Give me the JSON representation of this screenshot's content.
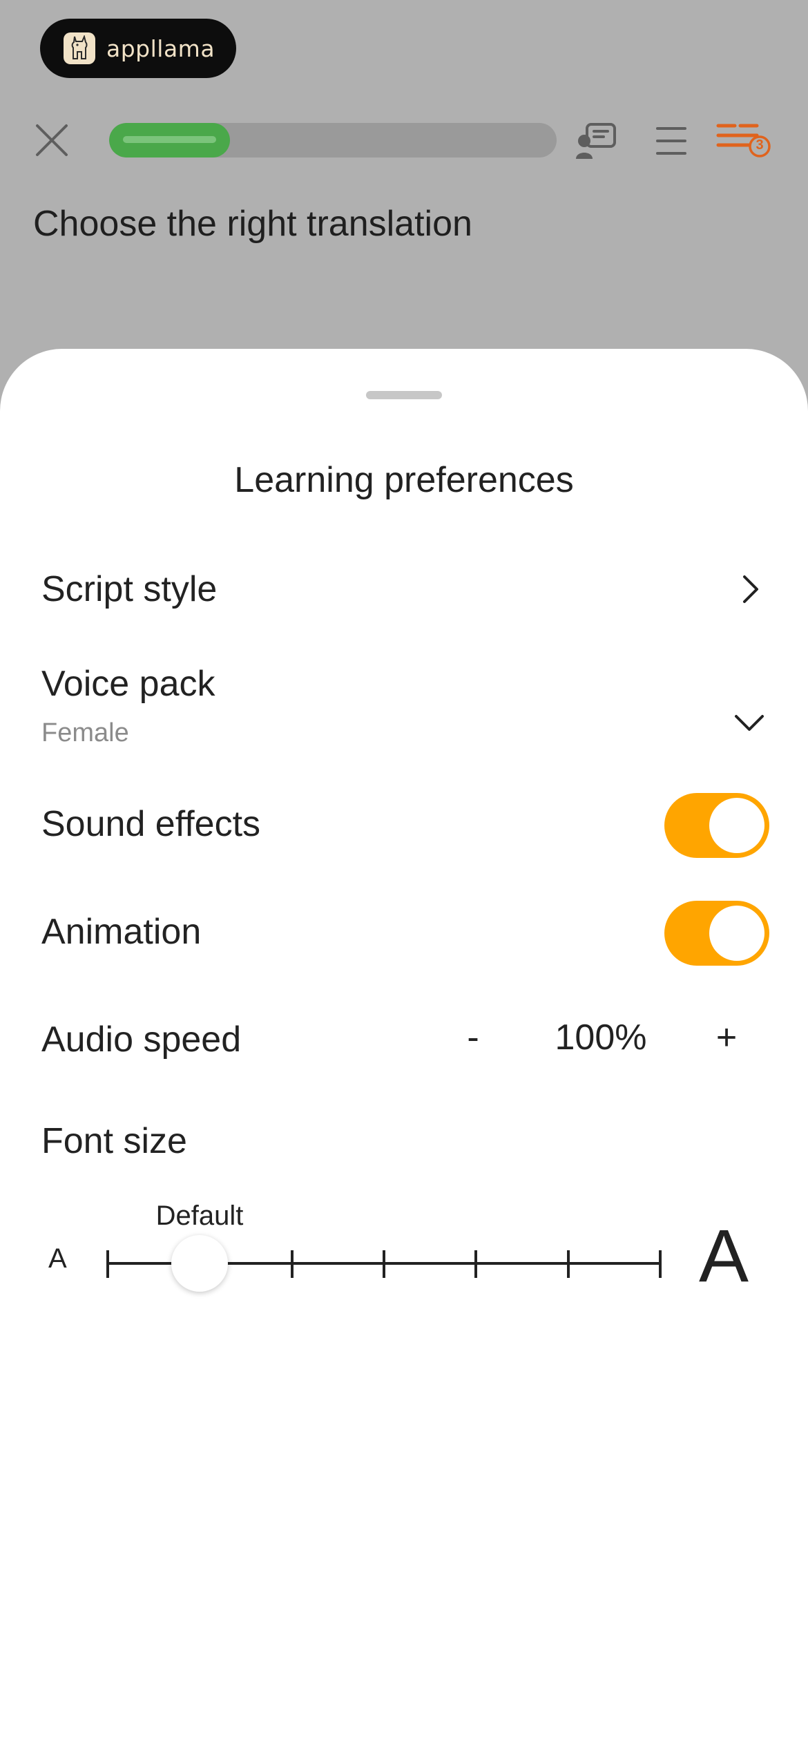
{
  "background": {
    "brand": {
      "name": "appllama",
      "icon": "llama-logo-icon"
    },
    "progress": {
      "fraction": 0.27,
      "color": "#4aa84a"
    },
    "header_icons": {
      "close": "close-icon",
      "hint": "hint-chat-icon",
      "menu": "menu-lines-icon",
      "streak": "streak-icon",
      "streak_count": "3"
    },
    "prompt": "Choose the right translation"
  },
  "sheet": {
    "title": "Learning preferences",
    "script_style": {
      "label": "Script style",
      "icon": "chevron-right-icon"
    },
    "voice_pack": {
      "label": "Voice pack",
      "value": "Female",
      "icon": "chevron-down-icon"
    },
    "sound_effects": {
      "label": "Sound effects",
      "enabled": true
    },
    "animation": {
      "label": "Animation",
      "enabled": true
    },
    "audio_speed": {
      "label": "Audio speed",
      "minus": "-",
      "value": "100%",
      "plus": "+"
    },
    "font_size": {
      "label": "Font size",
      "small_label": "A",
      "large_label": "A",
      "default_label": "Default",
      "steps": 7,
      "selected_step": 2
    }
  },
  "colors": {
    "accent": "#ffa500",
    "progress": "#4aa84a",
    "streak": "#e0631d"
  }
}
